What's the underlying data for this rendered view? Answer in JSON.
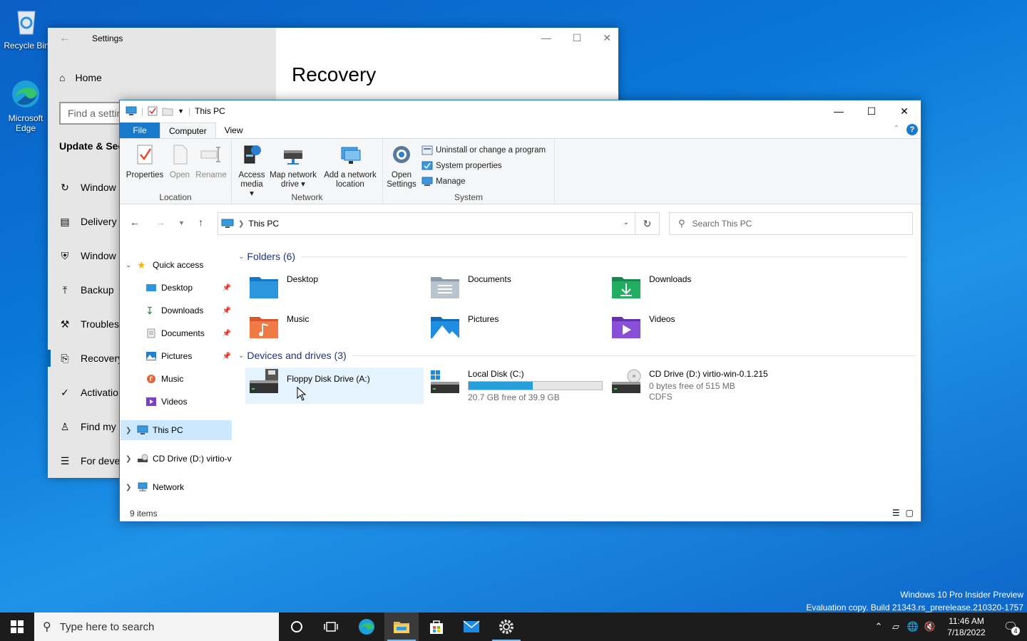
{
  "desktop": {
    "icons": [
      {
        "label": "Recycle Bin"
      },
      {
        "label": "Microsoft Edge"
      }
    ],
    "watermark_line1": "Windows 10 Pro Insider Preview",
    "watermark_line2": "Evaluation copy. Build 21343.rs_prerelease.210320-1757"
  },
  "settings": {
    "title": "Settings",
    "home": "Home",
    "search_placeholder": "Find a settin",
    "section": "Update & Sec",
    "nav_items": [
      {
        "label": "Window"
      },
      {
        "label": "Delivery"
      },
      {
        "label": "Window"
      },
      {
        "label": "Backup"
      },
      {
        "label": "Troubles"
      },
      {
        "label": "Recovery"
      },
      {
        "label": "Activatio"
      },
      {
        "label": "Find my"
      },
      {
        "label": "For deve"
      }
    ],
    "page_title": "Recovery"
  },
  "explorer": {
    "title": "This PC",
    "tabs": {
      "file": "File",
      "computer": "Computer",
      "view": "View"
    },
    "ribbon": {
      "location": {
        "label": "Location",
        "properties": "Properties",
        "open": "Open",
        "rename": "Rename"
      },
      "network": {
        "label": "Network",
        "access_media_1": "Access",
        "access_media_2": "media",
        "map_drive_1": "Map network",
        "map_drive_2": "drive",
        "add_location_1": "Add a network",
        "add_location_2": "location"
      },
      "system": {
        "label": "System",
        "open_settings_1": "Open",
        "open_settings_2": "Settings",
        "uninstall": "Uninstall or change a program",
        "system_properties": "System properties",
        "manage": "Manage"
      }
    },
    "address": "This PC",
    "search_placeholder": "Search This PC",
    "nav": {
      "quick_access": "Quick access",
      "items": [
        {
          "label": "Desktop"
        },
        {
          "label": "Downloads"
        },
        {
          "label": "Documents"
        },
        {
          "label": "Pictures"
        },
        {
          "label": "Music"
        },
        {
          "label": "Videos"
        }
      ],
      "this_pc": "This PC",
      "cd_drive": "CD Drive (D:) virtio-v",
      "network": "Network"
    },
    "folders_header": "Folders (6)",
    "folders": [
      {
        "label": "Desktop"
      },
      {
        "label": "Documents"
      },
      {
        "label": "Downloads"
      },
      {
        "label": "Music"
      },
      {
        "label": "Pictures"
      },
      {
        "label": "Videos"
      }
    ],
    "devices_header": "Devices and drives (3)",
    "drives": {
      "floppy": {
        "label": "Floppy Disk Drive (A:)"
      },
      "local": {
        "label": "Local Disk (C:)",
        "free": "20.7 GB free of 39.9 GB",
        "used_fraction": 0.48
      },
      "cd": {
        "label": "CD Drive (D:) virtio-win-0.1.215",
        "free": "0 bytes free of 515 MB",
        "fs": "CDFS"
      }
    },
    "status": "9 items"
  },
  "taskbar": {
    "search_placeholder": "Type here to search",
    "time": "11:46 AM",
    "date": "7/18/2022",
    "notifications": "4"
  }
}
